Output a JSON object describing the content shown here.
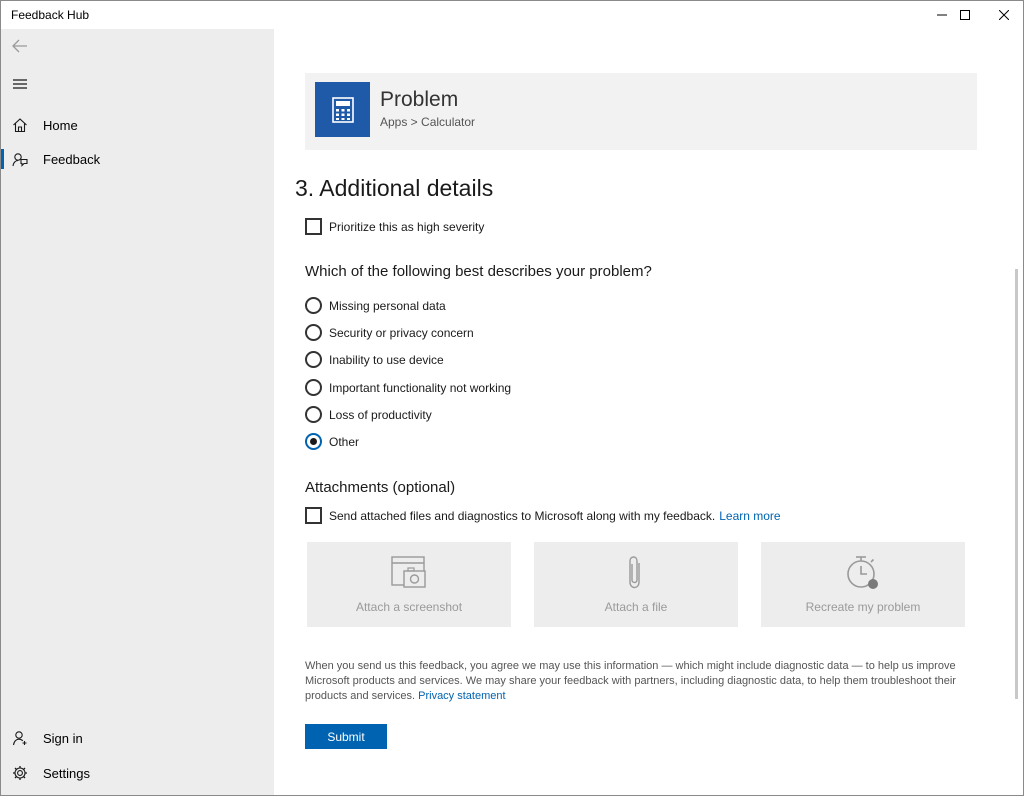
{
  "window": {
    "title": "Feedback Hub"
  },
  "sidebar": {
    "items": [
      {
        "label": "Home",
        "icon": "home-icon"
      },
      {
        "label": "Feedback",
        "icon": "feedback-icon"
      }
    ],
    "bottom_items": [
      {
        "label": "Sign in",
        "icon": "person-icon"
      },
      {
        "label": "Settings",
        "icon": "gear-icon"
      }
    ],
    "selected": "Feedback",
    "accent_color": "#0063b1"
  },
  "problem_card": {
    "title": "Problem",
    "breadcrumb": "Apps > Calculator",
    "app_icon": "calculator-icon",
    "tile_color": "#1e5aa8"
  },
  "details": {
    "section_title": "3. Additional details",
    "high_severity_label": "Prioritize this as high severity",
    "high_severity_checked": false,
    "question": "Which of the following best describes your problem?",
    "options": [
      {
        "label": "Missing personal data",
        "checked": false
      },
      {
        "label": "Security or privacy concern",
        "checked": false
      },
      {
        "label": "Inability to use device",
        "checked": false
      },
      {
        "label": "Important functionality not working",
        "checked": false
      },
      {
        "label": "Loss of productivity",
        "checked": false
      },
      {
        "label": "Other",
        "checked": true
      }
    ]
  },
  "attachments": {
    "title": "Attachments (optional)",
    "send_label": "Send attached files and diagnostics to Microsoft along with my feedback.",
    "learn_more": "Learn more",
    "send_checked": false,
    "buttons": [
      {
        "label": "Attach a screenshot",
        "icon": "screenshot-icon"
      },
      {
        "label": "Attach a file",
        "icon": "paperclip-icon"
      },
      {
        "label": "Recreate my problem",
        "icon": "timer-record-icon"
      }
    ]
  },
  "legal": {
    "text": "When you send us this feedback, you agree we may use this information — which might include diagnostic data — to help us improve Microsoft products and services. We may share your feedback with partners, including diagnostic data, to help them troubleshoot their products and services.",
    "privacy_link": "Privacy statement"
  },
  "submit_label": "Submit"
}
